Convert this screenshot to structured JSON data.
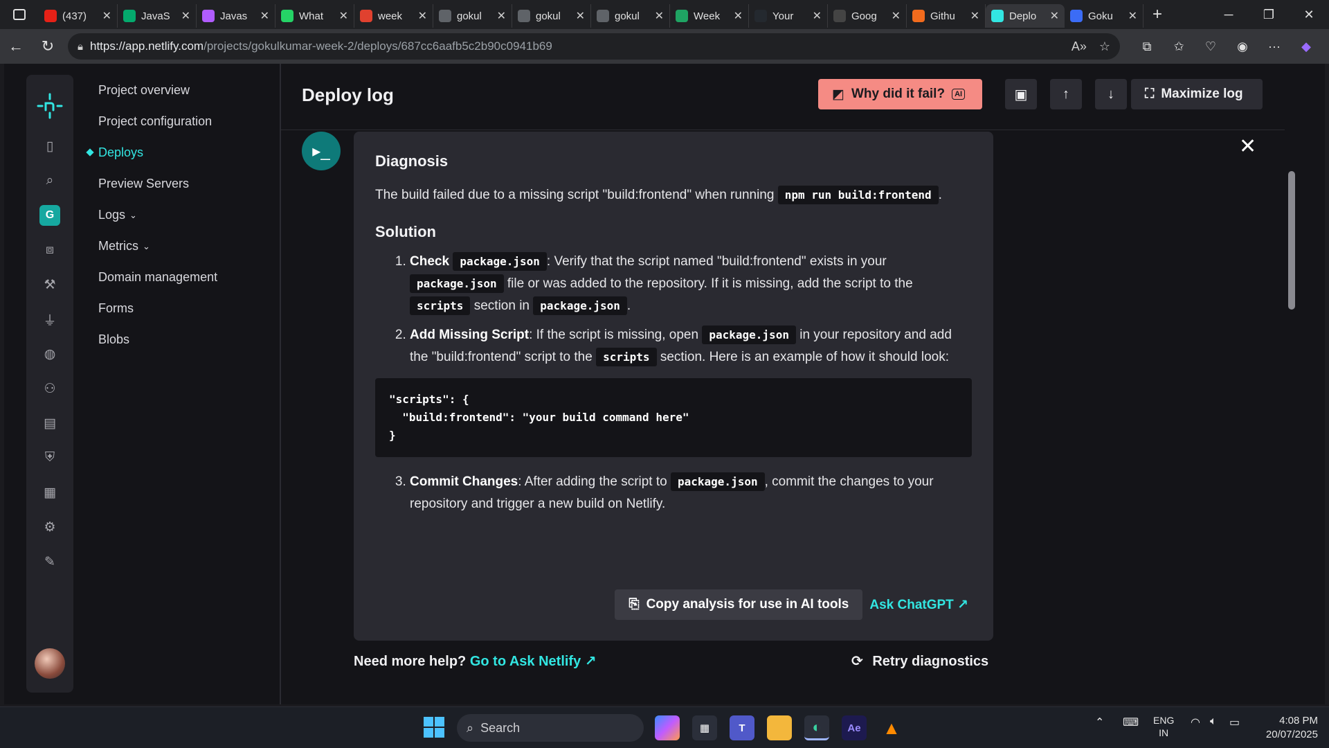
{
  "browser": {
    "tabs": [
      {
        "title": "(437)",
        "favicon": "youtube-icon",
        "color": "#e62117"
      },
      {
        "title": "JavaS",
        "favicon": "w3-icon",
        "color": "#04aa6d"
      },
      {
        "title": "Javas",
        "favicon": "spiral-icon",
        "color": "#b05cff"
      },
      {
        "title": "What",
        "favicon": "whatsapp-icon",
        "color": "#25d366"
      },
      {
        "title": "week",
        "favicon": "pdf-icon",
        "color": "#e0412f"
      },
      {
        "title": "gokul",
        "favicon": "globe-icon",
        "color": "#5f6368"
      },
      {
        "title": "gokul",
        "favicon": "link-icon",
        "color": "#5f6368"
      },
      {
        "title": "gokul",
        "favicon": "link-icon",
        "color": "#5f6368"
      },
      {
        "title": "Week",
        "favicon": "sheets-icon",
        "color": "#1fa463"
      },
      {
        "title": "Your",
        "favicon": "github-icon",
        "color": "#24292f"
      },
      {
        "title": "Goog",
        "favicon": "openai-icon",
        "color": "#444"
      },
      {
        "title": "Githu",
        "favicon": "apps-icon",
        "color": "#f26b1d"
      },
      {
        "title": "Deplo",
        "favicon": "netlify-icon",
        "color": "#32e6e2",
        "active": true
      },
      {
        "title": "Goku",
        "favicon": "shield-icon",
        "color": "#3b6cf6"
      }
    ],
    "url_host": "https://app.netlify.com",
    "url_path": "/projects/gokulkumar-week-2/deploys/687cc6aafb5c2b90c0941b69"
  },
  "sidebar": {
    "items": [
      {
        "label": "Project overview"
      },
      {
        "label": "Project configuration"
      },
      {
        "label": "Deploys",
        "active": true
      },
      {
        "label": "Preview Servers"
      },
      {
        "label": "Logs",
        "has_chevron": true
      },
      {
        "label": "Metrics",
        "has_chevron": true
      },
      {
        "label": "Domain management"
      },
      {
        "label": "Forms"
      },
      {
        "label": "Blobs"
      }
    ],
    "team_initial": "G"
  },
  "header": {
    "title": "Deploy log",
    "why_fail_label": "Why did it fail?",
    "ai_badge": "AI",
    "maximize_label": "Maximize log"
  },
  "diagnosis": {
    "heading": "Diagnosis",
    "text_before": "The build failed due to a missing script \"build:frontend\" when running",
    "code": "npm run build:frontend",
    "text_after": "."
  },
  "solution": {
    "heading": "Solution",
    "step1_title": "Check",
    "step1_code": "package.json",
    "step1_text_a": ": Verify that the script named \"build:frontend\" exists in your",
    "step1_code2": "package.json",
    "step1_text_b": "file or was added to the repository. If it is missing, add the script to the",
    "step1_code3": "scripts",
    "step1_text_c": "section in",
    "step1_code4": "package.json",
    "step1_text_d": ".",
    "step2_title": "Add Missing Script",
    "step2_text_a": ": If the script is missing, open",
    "step2_code": "package.json",
    "step2_text_b": "in your repository and add the \"build:frontend\" script to the",
    "step2_code2": "scripts",
    "step2_text_c": "section. Here is an example of how it should look:",
    "codeblock": "\"scripts\": {\n  \"build:frontend\": \"your build command here\"\n}",
    "step3_title": "Commit Changes",
    "step3_text_a": ": After adding the script to",
    "step3_code": "package.json",
    "step3_text_b": ", commit the changes to your repository and trigger a new build on Netlify."
  },
  "actions": {
    "copy_label": "Copy analysis for use in AI tools",
    "chatgpt_label": "Ask ChatGPT ↗"
  },
  "footer": {
    "help_text": "Need more help?",
    "help_link": "Go to Ask Netlify ↗",
    "retry_label": "Retry diagnostics"
  },
  "taskbar": {
    "search_placeholder": "Search",
    "lang_top": "ENG",
    "lang_bottom": "IN",
    "time": "4:08 PM",
    "date": "20/07/2025"
  }
}
